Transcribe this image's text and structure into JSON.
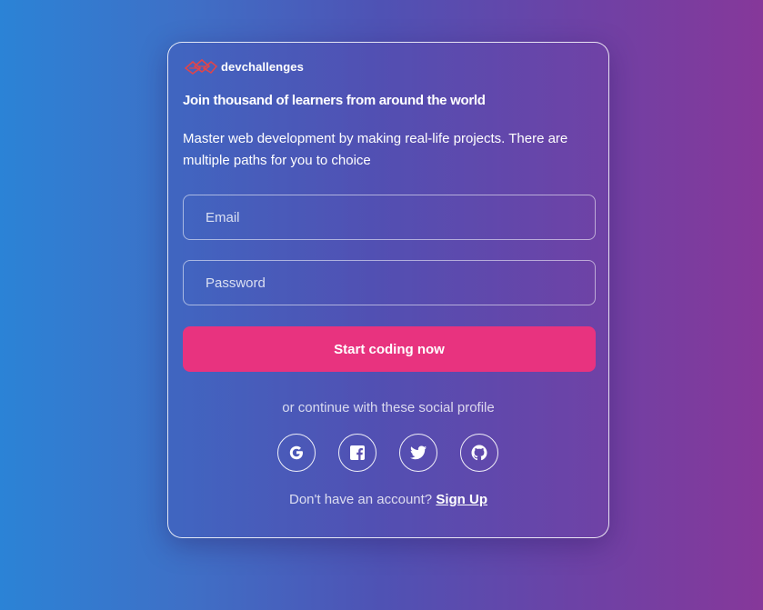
{
  "brand": {
    "name": "devchallenges",
    "logo_icon": "devchallenges-logo-icon",
    "logo_color": "#e0454a"
  },
  "headline": "Join thousand of learners from around the world",
  "subtext": "Master web development by making real-life projects. There are multiple paths for you to choice",
  "form": {
    "email_placeholder": "Email",
    "password_placeholder": "Password",
    "submit_label": "Start coding now"
  },
  "social": {
    "caption": "or continue with these social profile",
    "providers": [
      {
        "name": "Google",
        "icon": "google-icon"
      },
      {
        "name": "Facebook",
        "icon": "facebook-icon"
      },
      {
        "name": "Twitter",
        "icon": "twitter-icon"
      },
      {
        "name": "GitHub",
        "icon": "github-icon"
      }
    ]
  },
  "signup": {
    "prompt": "Don't have an account?",
    "link_label": "Sign Up"
  },
  "colors": {
    "accent": "#e8337f",
    "gradient_left": "#2b83d6",
    "gradient_right": "#86389a"
  }
}
